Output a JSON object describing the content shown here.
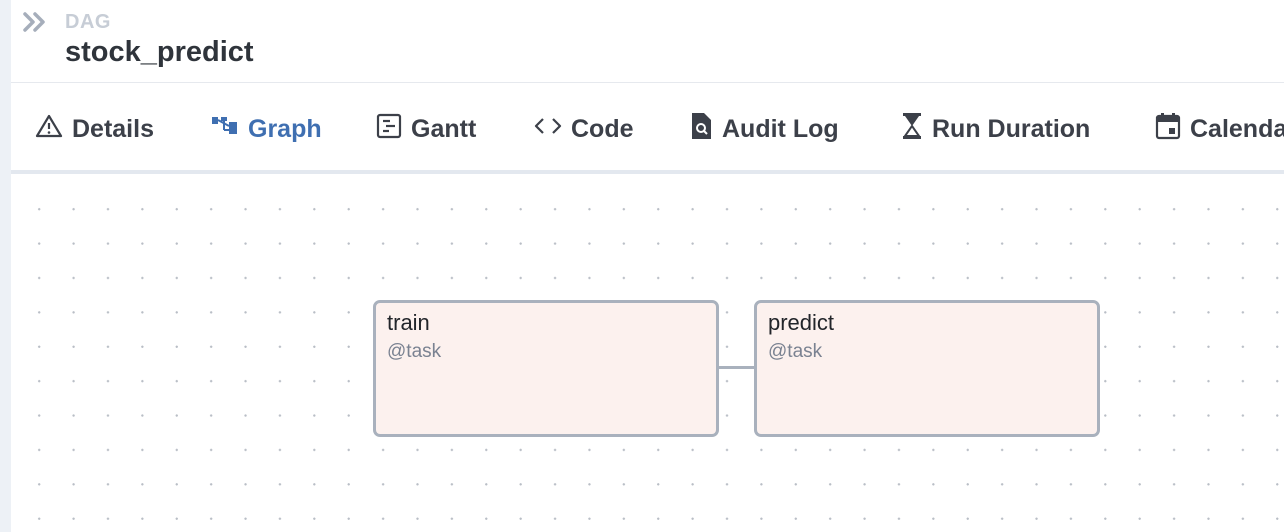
{
  "header": {
    "breadcrumb_label": "DAG",
    "dag_id": "stock_predict",
    "expand_icon": "double-chevron-right-icon"
  },
  "tabs": [
    {
      "label": "Details",
      "icon": "warning-triangle-icon",
      "active": false
    },
    {
      "label": "Graph",
      "icon": "graph-icon",
      "active": true
    },
    {
      "label": "Gantt",
      "icon": "gantt-icon",
      "active": false
    },
    {
      "label": "Code",
      "icon": "code-icon",
      "active": false
    },
    {
      "label": "Audit Log",
      "icon": "document-search-icon",
      "active": false
    },
    {
      "label": "Run Duration",
      "icon": "hourglass-icon",
      "active": false
    },
    {
      "label": "Calendar",
      "icon": "calendar-icon",
      "active": false
    }
  ],
  "graph": {
    "nodes": [
      {
        "name": "train",
        "type": "@task"
      },
      {
        "name": "predict",
        "type": "@task"
      }
    ],
    "edges": [
      {
        "from": "train",
        "to": "predict"
      }
    ]
  },
  "colors": {
    "accent": "#3f6fb1",
    "node_fill": "#fcf1ee",
    "node_border": "#a9b1bd"
  }
}
